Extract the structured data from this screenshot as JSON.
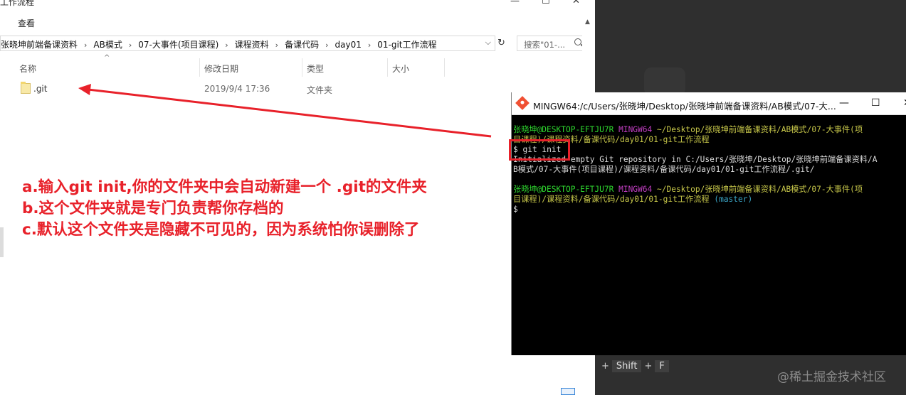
{
  "explorer": {
    "title": "工作流程",
    "controls": [
      "—",
      "☐",
      "✕"
    ],
    "ribbon_tab": "查看",
    "breadcrumb": [
      "张晓坤前端备课资料",
      "AB模式",
      "07-大事件(项目课程)",
      "课程资料",
      "备课代码",
      "day01",
      "01-git工作流程"
    ],
    "search_placeholder": "搜索\"01-...",
    "columns": [
      "名称",
      "修改日期",
      "类型",
      "大小"
    ],
    "rows": [
      {
        "name": ".git",
        "modified": "2019/9/4 17:36",
        "type": "文件夹",
        "size": ""
      }
    ]
  },
  "annotation": {
    "line_a": "a.输入git init,你的文件夹中会自动新建一个 .git的文件夹",
    "line_b": "b.这个文件夹就是专门负责帮你存档的",
    "line_c": "c.默认这个文件夹是隐藏不可见的，因为系统怕你误删除了",
    "color": "#e8212a"
  },
  "terminal": {
    "title": "MINGW64:/c/Users/张晓坤/Desktop/张晓坤前端备课资料/AB模式/07-大...",
    "controls": [
      "—",
      "☐",
      "✕"
    ],
    "line1_user": "张晓坤@DESKTOP-EFTJU7R",
    "line1_env": "MINGW64",
    "line1_path": "~/Desktop/张晓坤前端备课资料/AB模式/07-大事件(项",
    "line2_path": "目课程)/课程资料/备课代码/day01/01-git工作流程",
    "line3_cmd": "$ git init",
    "line4": "Initialized empty Git repository in C:/Users/张晓坤/Desktop/张晓坤前端备课资料/A",
    "line5": "B模式/07-大事件(项目课程)/课程资料/备课代码/day01/01-git工作流程/.git/",
    "line7_user": "张晓坤@DESKTOP-EFTJU7R",
    "line7_env": "MINGW64",
    "line7_path": "~/Desktop/张晓坤前端备课资料/AB模式/07-大事件(项",
    "line8_path": "目课程)/课程资料/备课代码/day01/01-git工作流程",
    "line8_branch": "(master)",
    "line9": "$"
  },
  "shortcut": {
    "plus1": "+",
    "key1": "Shift",
    "plus2": "+",
    "key2": "F"
  },
  "watermark": "@稀土掘金技术社区"
}
